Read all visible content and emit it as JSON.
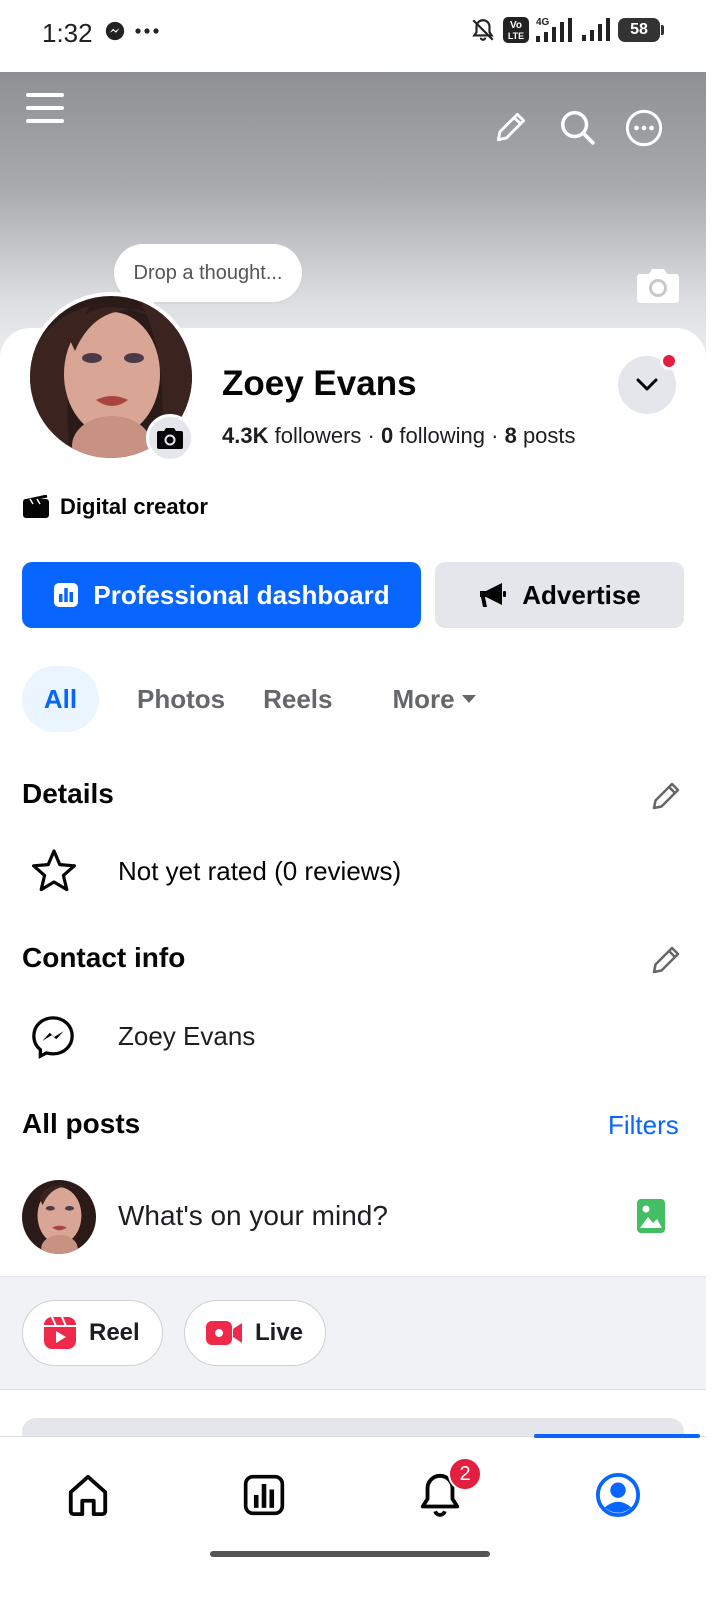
{
  "status_bar": {
    "time": "1:32",
    "battery": "58",
    "network": "4G",
    "volte": "Vo\nLTE"
  },
  "cover": {
    "thought_prompt": "Drop a thought..."
  },
  "profile": {
    "name": "Zoey Evans",
    "followers_count": "4.3K",
    "followers_label": "followers",
    "following_count": "0",
    "following_label": "following",
    "posts_count": "8",
    "posts_label": "posts",
    "separator": "·",
    "category": "Digital creator"
  },
  "actions": {
    "primary": "Professional dashboard",
    "secondary": "Advertise"
  },
  "tabs": [
    {
      "label": "All",
      "active": true
    },
    {
      "label": "Photos",
      "active": false
    },
    {
      "label": "Reels",
      "active": false
    },
    {
      "label": "More",
      "active": false
    }
  ],
  "details": {
    "title": "Details",
    "rating": "Not yet rated (0 reviews)"
  },
  "contact": {
    "title": "Contact info",
    "messenger": "Zoey Evans"
  },
  "posts": {
    "title": "All posts",
    "filters": "Filters",
    "composer_placeholder": "What's on your mind?"
  },
  "create_chips": [
    {
      "label": "Reel"
    },
    {
      "label": "Live"
    }
  ],
  "bottom_nav": {
    "notification_badge": "2"
  },
  "colors": {
    "brand_blue": "#0866ff",
    "badge_red": "#e41e3f",
    "reel_red": "#f02849",
    "photo_green": "#45bd62"
  },
  "icons": [
    "menu-icon",
    "pencil-icon",
    "search-icon",
    "more-icon",
    "camera-icon",
    "chevron-down-icon",
    "clapperboard-icon",
    "insights-icon",
    "megaphone-icon",
    "caret-down-icon",
    "star-icon",
    "messenger-icon",
    "photo-icon",
    "reel-icon",
    "live-video-icon",
    "home-icon",
    "dashboard-icon",
    "bell-icon",
    "profile-icon"
  ]
}
